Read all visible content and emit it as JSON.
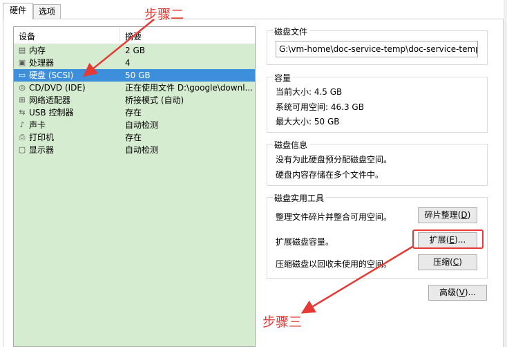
{
  "tabs": [
    {
      "label": "硬件",
      "active": true
    },
    {
      "label": "选项",
      "active": false
    }
  ],
  "device_list": {
    "headers": {
      "device": "设备",
      "summary": "摘要"
    },
    "rows": [
      {
        "icon": "memory-icon",
        "name": "内存",
        "summary": "2 GB",
        "selected": false
      },
      {
        "icon": "processor-icon",
        "name": "处理器",
        "summary": "4",
        "selected": false
      },
      {
        "icon": "hard-disk-icon",
        "name": "硬盘 (SCSI)",
        "summary": "50 GB",
        "selected": true
      },
      {
        "icon": "cd-dvd-icon",
        "name": "CD/DVD (IDE)",
        "summary": "正在使用文件 D:\\google\\downl...",
        "selected": false
      },
      {
        "icon": "network-adapter-icon",
        "name": "网络适配器",
        "summary": "桥接模式 (自动)",
        "selected": false
      },
      {
        "icon": "usb-icon",
        "name": "USB 控制器",
        "summary": "存在",
        "selected": false
      },
      {
        "icon": "sound-card-icon",
        "name": "声卡",
        "summary": "自动检测",
        "selected": false
      },
      {
        "icon": "printer-icon",
        "name": "打印机",
        "summary": "存在",
        "selected": false
      },
      {
        "icon": "display-icon",
        "name": "显示器",
        "summary": "自动检测",
        "selected": false
      }
    ]
  },
  "disk_file": {
    "title": "磁盘文件",
    "path": "G:\\vm-home\\doc-service-temp\\doc-service-temp.vm"
  },
  "capacity": {
    "title": "容量",
    "current_size": "当前大小: 4.5 GB",
    "system_available": "系统可用空间: 46.3 GB",
    "max_size": "最大大小: 50 GB"
  },
  "disk_info": {
    "title": "磁盘信息",
    "line1": "没有为此硬盘预分配磁盘空间。",
    "line2": "硬盘内容存储在多个文件中。"
  },
  "disk_utilities": {
    "title": "磁盘实用工具",
    "defrag_text": "整理文件碎片并整合可用空间。",
    "defrag_button": {
      "label": "碎片整理(",
      "mnemonic": "D",
      "suffix": ")"
    },
    "expand_text": "扩展磁盘容量。",
    "expand_button": {
      "label": "扩展(",
      "mnemonic": "E",
      "suffix": ")..."
    },
    "compact_text": "压缩磁盘以回收未使用的空间。",
    "compact_button": {
      "label": "压缩(",
      "mnemonic": "C",
      "suffix": ")"
    }
  },
  "advanced_button": {
    "label": "高级(",
    "mnemonic": "V",
    "suffix": ")..."
  },
  "annotations": {
    "top": "步骤二",
    "bottom": "步骤三",
    "color": "#e53935"
  },
  "colors": {
    "list_background": "#d6ecd1",
    "selection": "#3d8fdc"
  }
}
